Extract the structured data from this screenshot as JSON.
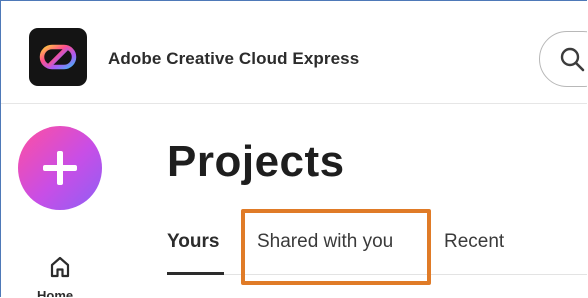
{
  "header": {
    "app_title": "Adobe Creative Cloud Express",
    "logo_icon": "creative-cloud-logo-icon",
    "search_icon": "search-icon"
  },
  "sidebar": {
    "create_button_icon": "plus-icon",
    "items": [
      {
        "label": "Home",
        "icon": "home-icon"
      }
    ]
  },
  "main": {
    "title": "Projects",
    "tabs": [
      {
        "label": "Yours",
        "selected": true
      },
      {
        "label": "Shared with you",
        "selected": false,
        "highlighted": true
      },
      {
        "label": "Recent",
        "selected": false
      }
    ]
  },
  "colors": {
    "highlight": "#e07b27",
    "create_gradient_start": "#ff4fa0",
    "create_gradient_end": "#8e5ff5",
    "frame_border": "#4e79b8"
  }
}
